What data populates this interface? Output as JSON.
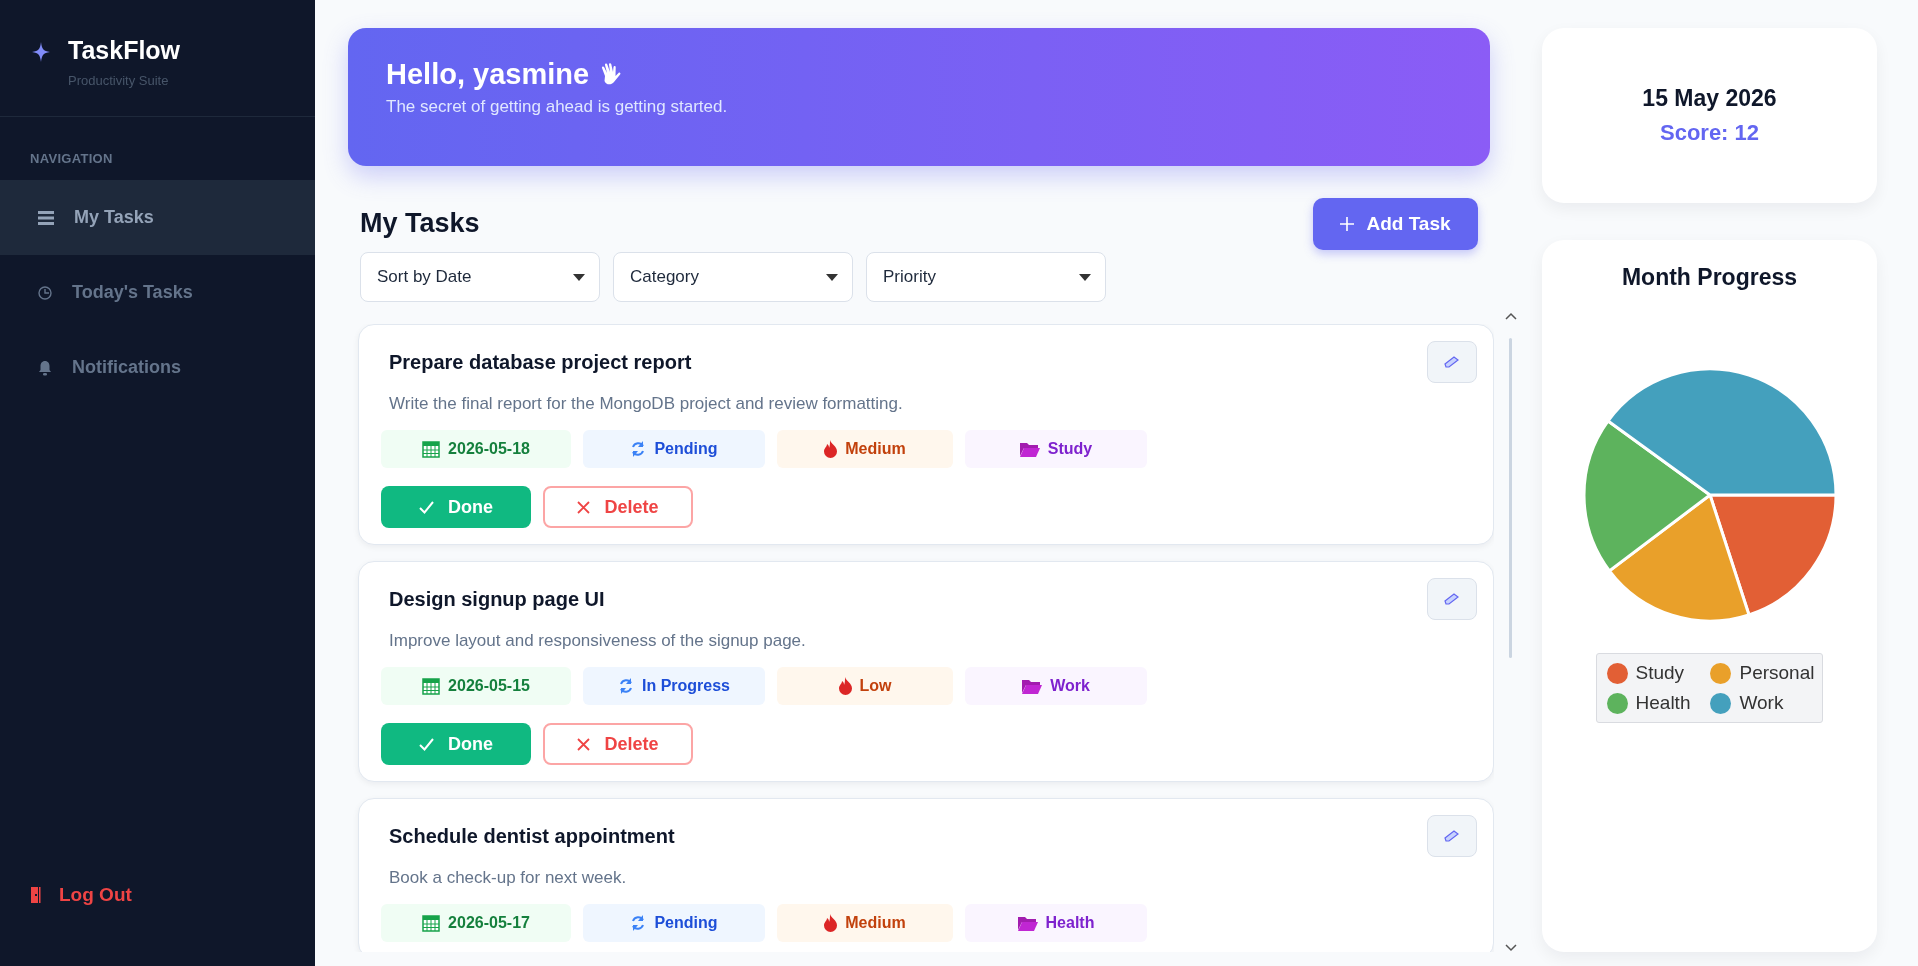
{
  "sidebar": {
    "brand": {
      "name": "TaskFlow",
      "tagline": "Productivity Suite"
    },
    "section_label": "NAVIGATION",
    "items": [
      {
        "label": "My Tasks",
        "selected": true
      },
      {
        "label": "Today's Tasks",
        "selected": false
      },
      {
        "label": "Notifications",
        "selected": false
      }
    ],
    "logout": "Log Out"
  },
  "banner": {
    "greeting": "Hello, yasmine",
    "quote": "The secret of getting ahead is getting started."
  },
  "tasks_header": {
    "title": "My Tasks",
    "add_button": "Add Task"
  },
  "filters": [
    {
      "label": "Sort by Date"
    },
    {
      "label": "Category"
    },
    {
      "label": "Priority"
    }
  ],
  "tasks": [
    {
      "title": "Prepare database project report",
      "description": "Write the final report for the MongoDB project and review formatting.",
      "date": "2026-05-18",
      "status": "Pending",
      "priority": "Medium",
      "category": "Study",
      "done_button": "Done",
      "delete_button": "Delete"
    },
    {
      "title": "Design signup page UI",
      "description": "Improve layout and responsiveness of the signup page.",
      "date": "2026-05-15",
      "status": "In Progress",
      "priority": "Low",
      "category": "Work",
      "done_button": "Done",
      "delete_button": "Delete"
    },
    {
      "title": "Schedule dentist appointment",
      "description": "Book a check-up for next week.",
      "date": "2026-05-17",
      "status": "Pending",
      "priority": "Medium",
      "category": "Health"
    }
  ],
  "date_card": {
    "date": "15 May 2026",
    "score": "Score: 12"
  },
  "progress": {
    "title": "Month Progress",
    "legend": [
      {
        "label": "Study",
        "color": "#e25f35"
      },
      {
        "label": "Personal",
        "color": "#e9a02a"
      },
      {
        "label": "Health",
        "color": "#5db35d"
      },
      {
        "label": "Work",
        "color": "#44a0bd"
      }
    ]
  }
}
